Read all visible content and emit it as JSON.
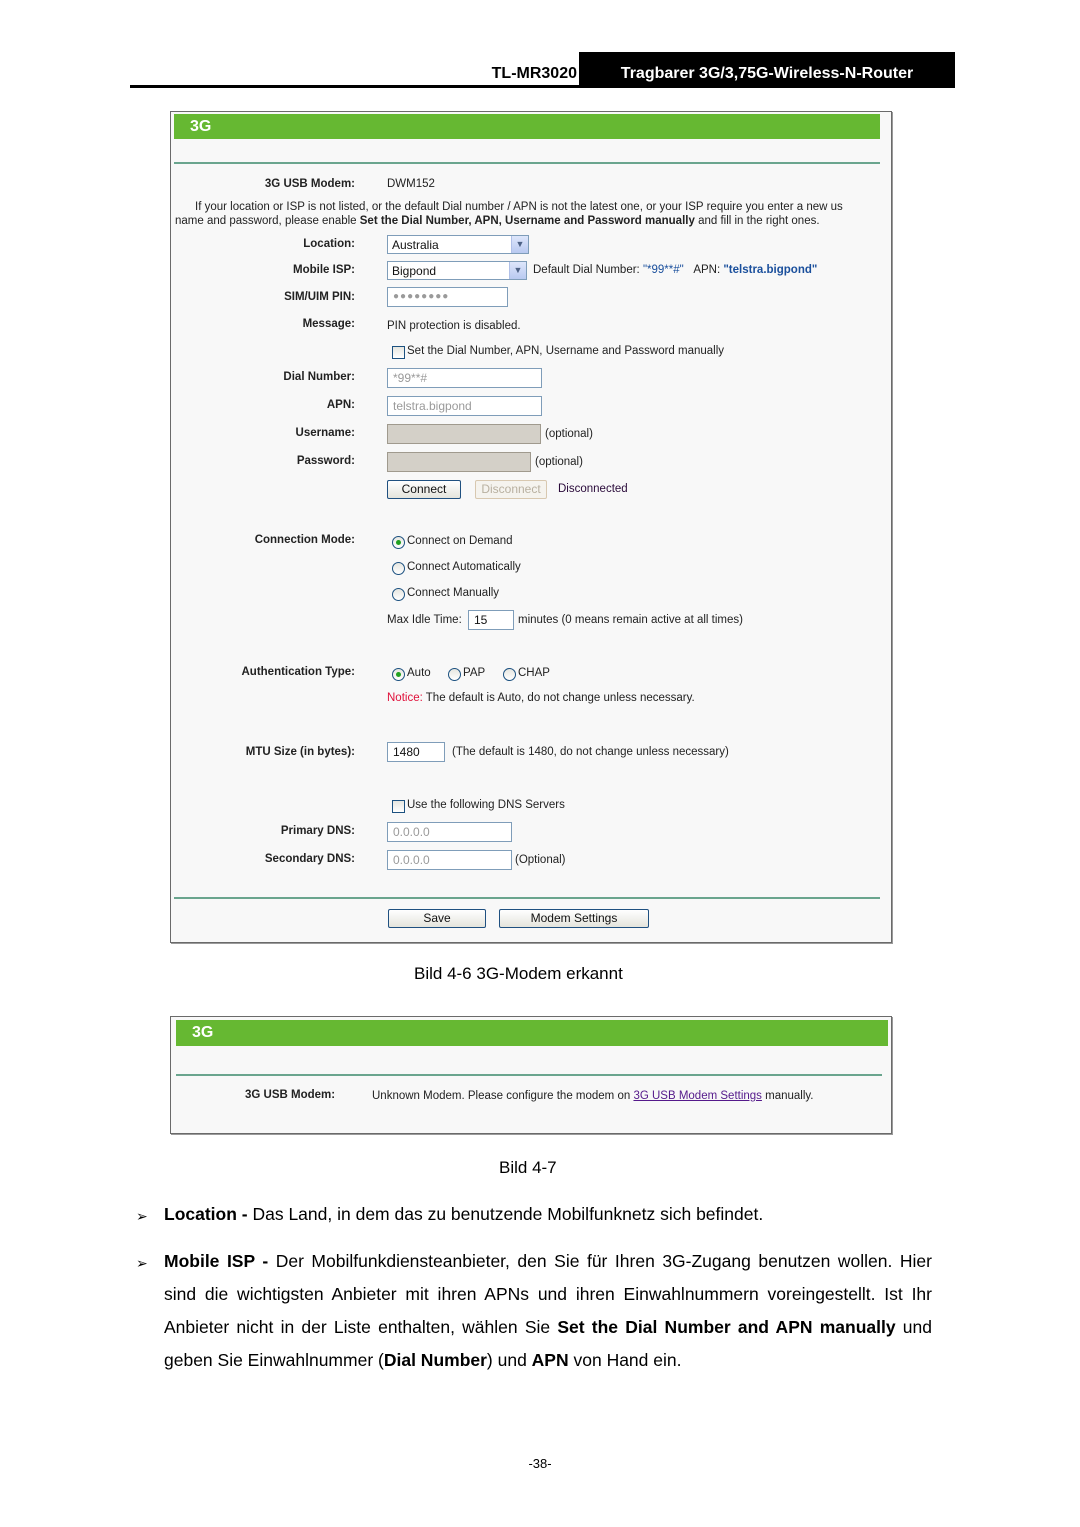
{
  "header": {
    "model": "TL-MR3020",
    "title": "Tragbarer 3G/3,75G-Wireless-N-Router"
  },
  "figure1": {
    "panel_title": "3G",
    "usb_modem_label": "3G USB Modem:",
    "usb_modem_value": "DWM152",
    "info_line1": "If your location or ISP is not listed, or the default Dial number / APN is not the latest one, or your ISP require you enter a new us",
    "info_line2_pre": "name and password, please enable ",
    "info_line2_bold": "Set the Dial Number, APN, Username and Password manually",
    "info_line2_post": " and fill in the right ones.",
    "location_label": "Location:",
    "location_value": "Australia",
    "isp_label": "Mobile ISP:",
    "isp_value": "Bigpond",
    "default_dial_label": "Default Dial Number:",
    "default_dial_value": "\"*99**#\"",
    "apn_info_label": "APN:",
    "apn_info_value": "\"telstra.bigpond\"",
    "pin_label": "SIM/UIM PIN:",
    "pin_value": "●●●●●●●●",
    "message_label": "Message:",
    "message_value": "PIN protection is disabled.",
    "manual_checkbox_label": "Set the Dial Number, APN, Username and Password manually",
    "manual_checked": false,
    "dial_label": "Dial Number:",
    "dial_value": "*99**#",
    "apn_label": "APN:",
    "apn_value": "telstra.bigpond",
    "username_label": "Username:",
    "username_value": "",
    "username_hint": "(optional)",
    "password_label": "Password:",
    "password_value": "",
    "password_hint": "(optional)",
    "connect_button": "Connect",
    "disconnect_button": "Disconnect",
    "connection_status": "Disconnected",
    "mode_label": "Connection Mode:",
    "mode_options": [
      "Connect on Demand",
      "Connect Automatically",
      "Connect Manually"
    ],
    "mode_selected": "Connect on Demand",
    "idle_label": "Max Idle Time:",
    "idle_value": "15",
    "idle_hint": "minutes (0 means remain active at all times)",
    "auth_label": "Authentication Type:",
    "auth_options": [
      "Auto",
      "PAP",
      "CHAP"
    ],
    "auth_selected": "Auto",
    "notice_label": "Notice:",
    "notice_text": " The default is Auto, do not change unless necessary.",
    "mtu_label": "MTU Size (in bytes):",
    "mtu_value": "1480",
    "mtu_hint": "(The default is 1480, do not change unless necessary)",
    "dns_checkbox_label": "Use the following DNS Servers",
    "dns_checked": false,
    "primary_dns_label": "Primary DNS:",
    "primary_dns_value": "0.0.0.0",
    "secondary_dns_label": "Secondary DNS:",
    "secondary_dns_value": "0.0.0.0",
    "secondary_dns_hint": "(Optional)",
    "save_button": "Save",
    "modem_settings_button": "Modem Settings",
    "caption": "Bild 4-6 3G-Modem erkannt"
  },
  "figure2": {
    "panel_title": "3G",
    "usb_modem_label": "3G USB Modem:",
    "message_pre": "Unknown Modem. Please configure the modem on ",
    "message_link": "3G USB Modem Settings",
    "message_post": " manually.",
    "caption": "Bild 4-7"
  },
  "body": {
    "bullet_glyph": "➢",
    "location_term": "Location -",
    "location_text": " Das Land, in dem das zu benutzende Mobilfunknetz sich befindet.",
    "isp_term": "Mobile ISP -",
    "isp_text1": " Der Mobilfunkdiensteanbieter, den Sie für Ihren 3G-Zugang benutzen wollen. Hier sind die wichtigsten Anbieter mit ihren APNs und ihren Einwahlnummern voreingestellt. Ist Ihr Anbieter nicht in der Liste enthalten, wählen Sie ",
    "isp_bold1": "Set the Dial Number and APN manually",
    "isp_text2": " und geben Sie Einwahlnummer (",
    "isp_bold2": "Dial Number",
    "isp_text3": ") und ",
    "isp_bold3": "APN",
    "isp_text4": " von Hand ein."
  },
  "page_number": "-38-"
}
